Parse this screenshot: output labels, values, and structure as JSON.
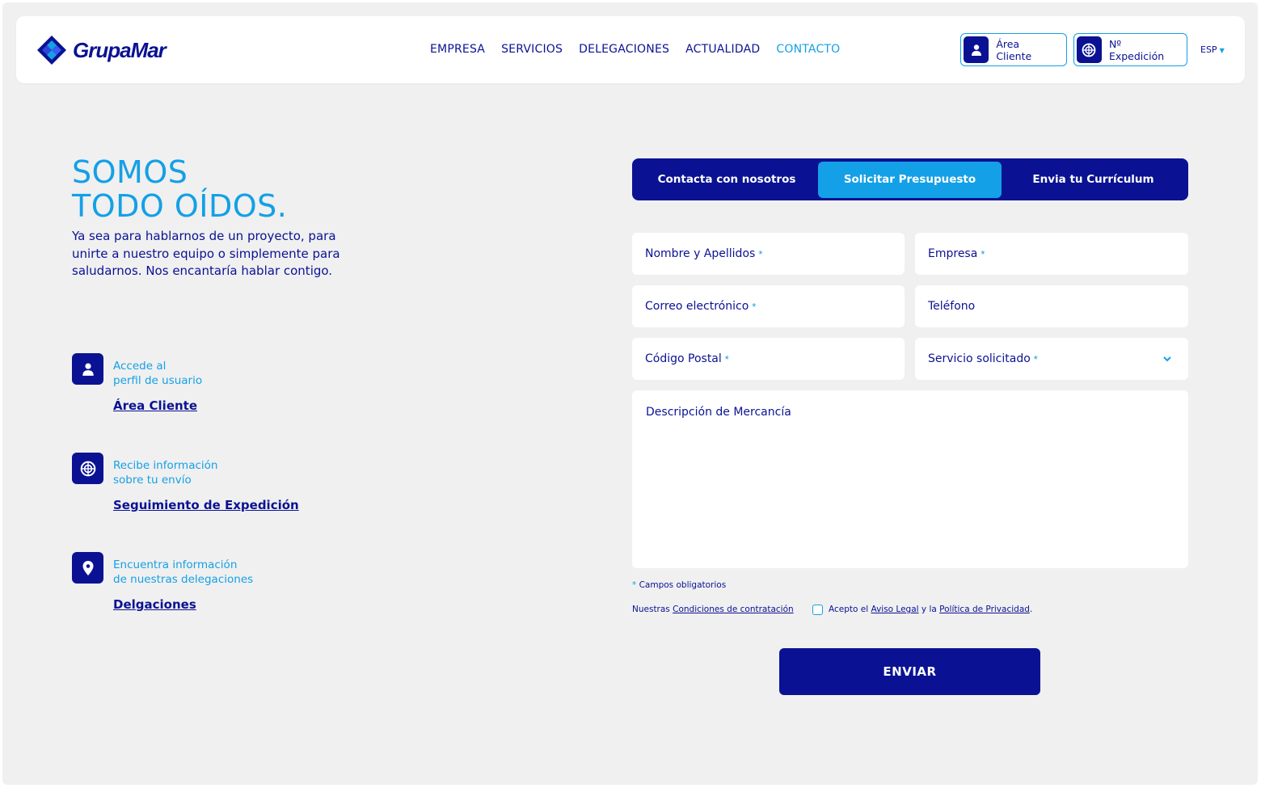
{
  "brand": {
    "name": "GrupaMar",
    "primary_color": "#0a1293",
    "accent_color": "#14a0e6",
    "logo_icon": "diamond-logo-icon"
  },
  "nav": {
    "items": [
      {
        "label": "EMPRESA",
        "active": false
      },
      {
        "label": "SERVICIOS",
        "active": false
      },
      {
        "label": "DELEGACIONES",
        "active": false
      },
      {
        "label": "ACTUALIDAD",
        "active": false
      },
      {
        "label": "CONTACTO",
        "active": true
      }
    ]
  },
  "header_buttons": {
    "client_area": {
      "label": "Área Cliente",
      "icon": "user-icon"
    },
    "expedition": {
      "label": "Nº Expedición",
      "icon": "tracking-wheel-icon"
    }
  },
  "language": {
    "current": "ESP"
  },
  "hero": {
    "title_line1": "SOMOS",
    "title_line2": "TODO OÍDOS.",
    "intro": "Ya sea para hablarnos de un proyecto, para unirte a nuestro equipo o simplemente para saludarnos. Nos encantaría hablar contigo."
  },
  "info_blocks": [
    {
      "icon": "user-icon",
      "line1": "Accede al",
      "line2": "perfil de usuario",
      "link": "Área Cliente"
    },
    {
      "icon": "tracking-wheel-icon",
      "line1": "Recibe información",
      "line2": "sobre tu envío",
      "link": "Seguimiento de Expedición"
    },
    {
      "icon": "location-pin-icon",
      "line1": "Encuentra información",
      "line2": "de nuestras delegaciones",
      "link": "Delgaciones"
    }
  ],
  "tabs": [
    {
      "label": "Contacta con nosotros",
      "active": false
    },
    {
      "label": "Solicitar Presupuesto",
      "active": true
    },
    {
      "label": "Envia tu Currículum",
      "active": false
    }
  ],
  "form": {
    "name": {
      "placeholder": "Nombre y Apellidos",
      "required_mark": "*"
    },
    "company": {
      "placeholder": "Empresa",
      "required_mark": "*"
    },
    "email": {
      "placeholder": "Correo electrónico",
      "required_mark": "*"
    },
    "phone": {
      "placeholder": "Teléfono"
    },
    "postal": {
      "placeholder": "Código Postal",
      "required_mark": "*"
    },
    "service": {
      "placeholder": "Servicio solicitado",
      "required_mark": "*"
    },
    "description": {
      "placeholder": "Descripción de Mercancía"
    },
    "required_note_star": "*",
    "required_note": "Campos obligatorios",
    "conditions_prefix": "Nuestras",
    "conditions_link": "Condiciones de contratación",
    "accept_prefix": "Acepto el",
    "legal_link": "Aviso Legal",
    "accept_and": "y la",
    "privacy_link": "Política de Privacidad",
    "accept_suffix": ".",
    "submit_label": "ENVIAR"
  }
}
